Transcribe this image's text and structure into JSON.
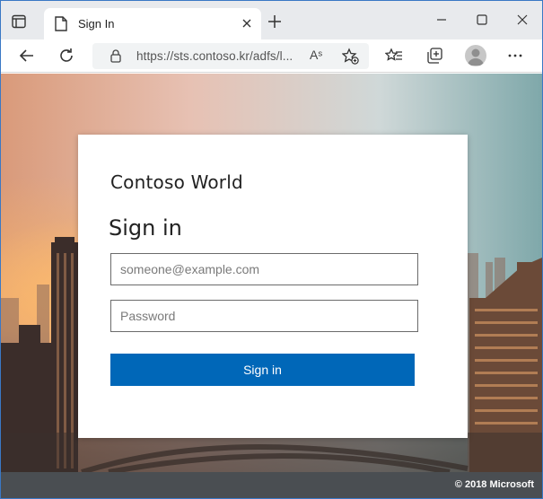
{
  "browser": {
    "tab": {
      "title": "Sign In"
    },
    "address": {
      "url": "https://sts.contoso.kr/adfs/l...",
      "read_aloud_glyph": "Aˢ"
    }
  },
  "signin": {
    "organization": "Contoso World",
    "heading": "Sign in",
    "username": {
      "placeholder": "someone@example.com",
      "value": ""
    },
    "password": {
      "placeholder": "Password",
      "value": ""
    },
    "submit_label": "Sign in"
  },
  "footer": {
    "copyright": "© 2018 Microsoft"
  },
  "colors": {
    "accent": "#0067b8",
    "footer": "#4a4e52",
    "window_border": "#3a78c5"
  }
}
